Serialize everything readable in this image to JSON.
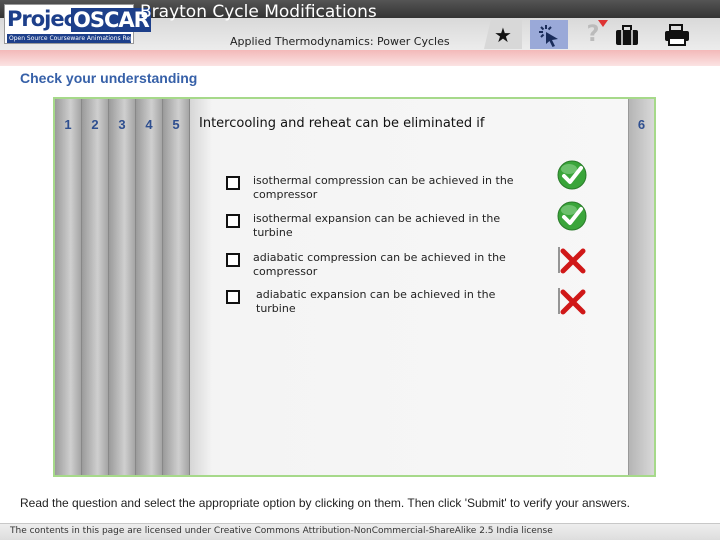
{
  "header": {
    "logo": {
      "word1": "Project",
      "word2": "OSCAR",
      "tagline": "Open Source Courseware Animations Repository"
    },
    "title": "Brayton Cycle Modifications",
    "subtitle": "Applied Thermodynamics: Power Cycles",
    "toolbar": [
      {
        "icon": "star-icon"
      },
      {
        "icon": "pointer-icon"
      },
      {
        "icon": "help-icon",
        "label": "?"
      },
      {
        "icon": "briefcase-icon"
      },
      {
        "icon": "print-icon"
      }
    ]
  },
  "section_title": "Check your understanding",
  "quiz": {
    "tabs": [
      "1",
      "2",
      "3",
      "4",
      "5"
    ],
    "right_tab": "6",
    "question": "Intercooling and reheat can be eliminated if",
    "options": [
      {
        "text": "isothermal compression can be achieved in the compressor",
        "result": "correct",
        "checked": false
      },
      {
        "text": "isothermal expansion can be achieved in the turbine",
        "result": "correct",
        "checked": false
      },
      {
        "text": "adiabatic compression can be achieved in the compressor",
        "result": "incorrect",
        "checked": false
      },
      {
        "text": "adiabatic expansion can be achieved in the turbine",
        "result": "incorrect",
        "checked": false
      }
    ]
  },
  "instruction": "Read the question and select the appropriate option by clicking on them. Then click 'Submit' to verify your answers.",
  "footer": "The contents in this page are licensed under Creative Commons Attribution-NonCommercial-ShareAlike 2.5 India license",
  "colors": {
    "accent_blue": "#3660a8",
    "panel_border": "#a6d98a",
    "correct": "#3aa53a",
    "incorrect": "#d01818"
  }
}
